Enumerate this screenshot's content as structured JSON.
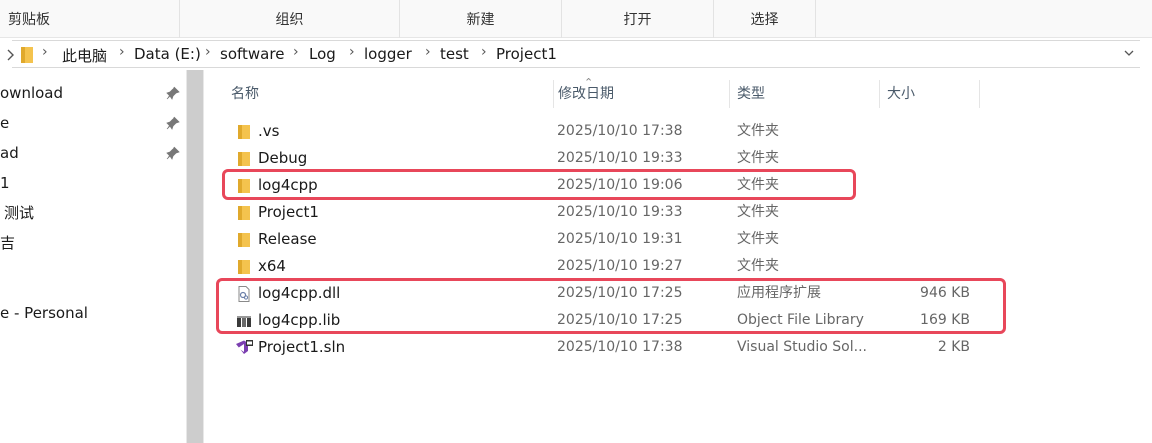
{
  "ribbon": {
    "groups": [
      "剪贴板",
      "组织",
      "新建",
      "打开",
      "选择"
    ]
  },
  "address": {
    "crumbs": [
      "此电脑",
      "Data (E:)",
      "software",
      "Log",
      "logger",
      "test",
      "Project1"
    ]
  },
  "nav": {
    "items": [
      "ownload",
      "e",
      "ad",
      "1",
      "测试",
      "吉",
      "e - Personal"
    ]
  },
  "columns": {
    "name": "名称",
    "date": "修改日期",
    "type": "类型",
    "size": "大小"
  },
  "files": [
    {
      "name": ".vs",
      "date": "2025/10/10 17:38",
      "type": "文件夹",
      "size": "",
      "icon": "folder-icon"
    },
    {
      "name": "Debug",
      "date": "2025/10/10 19:33",
      "type": "文件夹",
      "size": "",
      "icon": "folder-icon"
    },
    {
      "name": "log4cpp",
      "date": "2025/10/10 19:06",
      "type": "文件夹",
      "size": "",
      "icon": "folder-icon"
    },
    {
      "name": "Project1",
      "date": "2025/10/10 19:33",
      "type": "文件夹",
      "size": "",
      "icon": "folder-icon"
    },
    {
      "name": "Release",
      "date": "2025/10/10 19:31",
      "type": "文件夹",
      "size": "",
      "icon": "folder-icon"
    },
    {
      "name": "x64",
      "date": "2025/10/10 19:27",
      "type": "文件夹",
      "size": "",
      "icon": "folder-icon"
    },
    {
      "name": "log4cpp.dll",
      "date": "2025/10/10 17:25",
      "type": "应用程序扩展",
      "size": "946 KB",
      "icon": "dll-file-icon"
    },
    {
      "name": "log4cpp.lib",
      "date": "2025/10/10 17:25",
      "type": "Object File Library",
      "size": "169 KB",
      "icon": "lib-file-icon"
    },
    {
      "name": "Project1.sln",
      "date": "2025/10/10 17:38",
      "type": "Visual Studio Sol...",
      "size": "2 KB",
      "icon": "visual-studio-solution-icon"
    }
  ],
  "colors": {
    "highlight": "#e8475a",
    "folder": "#f4c34e"
  }
}
